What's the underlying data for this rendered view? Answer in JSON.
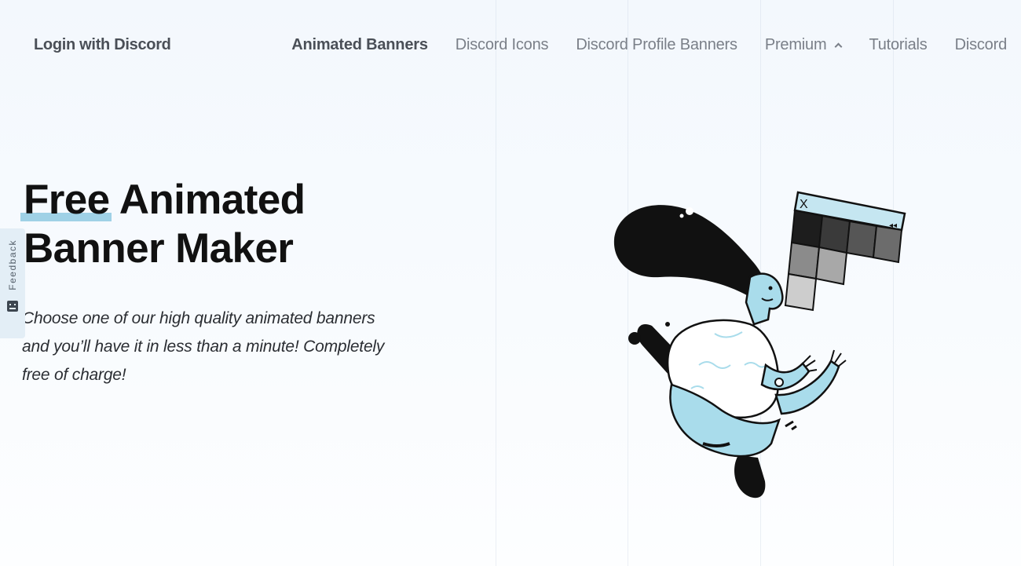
{
  "header": {
    "login_label": "Login with Discord",
    "nav": [
      {
        "label": "Animated Banners",
        "active": true
      },
      {
        "label": "Discord Icons",
        "active": false
      },
      {
        "label": "Discord Profile Banners",
        "active": false
      },
      {
        "label": "Premium",
        "active": false,
        "dropdown": true
      },
      {
        "label": "Tutorials",
        "active": false
      },
      {
        "label": "Discord",
        "active": false
      }
    ]
  },
  "hero": {
    "title_word1": "Free",
    "title_rest_line1": "Animated",
    "title_line2": "Banner Maker",
    "description": "Choose one of our high quality animated banners and you’ll have it in less than a minute! Completely free of charge!"
  },
  "feedback": {
    "label": "Feedback",
    "icon": "chat-icon"
  },
  "illustration": {
    "window_close_glyph": "X",
    "window_control_glyph": "◂◂"
  },
  "colors": {
    "accent": "#9fd1e6",
    "text_dark": "#111111",
    "nav_muted": "#7a7f88",
    "background": "#f6f9fc"
  }
}
